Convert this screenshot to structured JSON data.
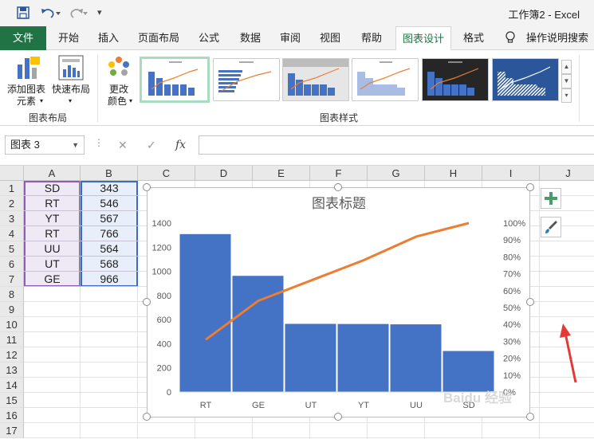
{
  "title_bar": {
    "app_title": "工作簿2  -  Excel"
  },
  "tabs": [
    {
      "label": "文件"
    },
    {
      "label": "开始"
    },
    {
      "label": "插入"
    },
    {
      "label": "页面布局"
    },
    {
      "label": "公式"
    },
    {
      "label": "数据"
    },
    {
      "label": "审阅"
    },
    {
      "label": "视图"
    },
    {
      "label": "帮助"
    },
    {
      "label": "图表设计"
    },
    {
      "label": "格式"
    }
  ],
  "tell_me": "操作说明搜索",
  "ribbon": {
    "add_element_l1": "添加图表",
    "add_element_l2": "元素",
    "quick_layout": "快速布局",
    "change_colors_l1": "更改",
    "change_colors_l2": "颜色",
    "group_layout": "图表布局",
    "group_styles": "图表样式"
  },
  "formula_bar": {
    "name_box": "图表 3",
    "fx": "fx"
  },
  "columns": [
    "A",
    "B",
    "C",
    "D",
    "E",
    "F",
    "G",
    "H",
    "I",
    "J"
  ],
  "rows": [
    "1",
    "2",
    "3",
    "4",
    "5",
    "6",
    "7",
    "8",
    "9",
    "10",
    "11",
    "12",
    "13",
    "14",
    "15",
    "16",
    "17"
  ],
  "table": [
    {
      "name": "SD",
      "value": "343"
    },
    {
      "name": "RT",
      "value": "546"
    },
    {
      "name": "YT",
      "value": "567"
    },
    {
      "name": "RT",
      "value": "766"
    },
    {
      "name": "UU",
      "value": "564"
    },
    {
      "name": "UT",
      "value": "568"
    },
    {
      "name": "GE",
      "value": "966"
    }
  ],
  "chart_data": {
    "type": "bar",
    "title": "图表标题",
    "categories": [
      "RT",
      "GE",
      "UT",
      "YT",
      "UU",
      "SD"
    ],
    "series": [
      {
        "kind": "bar",
        "values": [
          1312,
          966,
          568,
          567,
          564,
          343
        ],
        "color": "#4472c4"
      },
      {
        "kind": "line",
        "axis": "secondary",
        "values": [
          0.31,
          0.54,
          0.66,
          0.78,
          0.92,
          1.0
        ],
        "color": "#ed7d31"
      }
    ],
    "y_ticks": [
      "0",
      "200",
      "400",
      "600",
      "800",
      "1000",
      "1200",
      "1400"
    ],
    "ylim": [
      0,
      1400
    ],
    "y2_ticks": [
      "0%",
      "10%",
      "20%",
      "30%",
      "40%",
      "50%",
      "60%",
      "70%",
      "80%",
      "90%",
      "100%"
    ],
    "y2lim": [
      0,
      1
    ],
    "gridlines": false,
    "legend": "none"
  },
  "colors": {
    "excel_green": "#217346",
    "bar_blue": "#4472c4",
    "line_orange": "#ed7d31",
    "arrow_red": "#e53935"
  },
  "watermark": "Baidu 经验"
}
